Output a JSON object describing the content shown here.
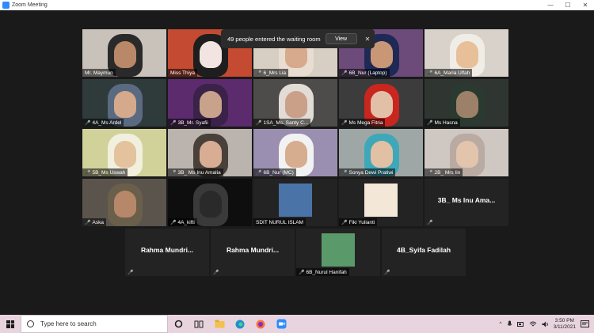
{
  "window": {
    "title": "Zoom Meeting",
    "minimize": "—",
    "maximize": "☐",
    "close": "✕"
  },
  "toast": {
    "message": "49 people entered the waiting room",
    "view_label": "View",
    "close_label": "✕"
  },
  "participants": [
    {
      "name": "Mr. Maymun",
      "muted": false,
      "type": "video",
      "bg": "#c9c2bb",
      "skin": "#b98868",
      "hair": "#2a2a2a"
    },
    {
      "name": "Miss Thiya",
      "muted": false,
      "type": "video",
      "speaking": true,
      "bg": "#c44a32",
      "skin": "#f2e4e0",
      "hair": "#1e1e1e"
    },
    {
      "name": "6_Mrs Lia",
      "muted": true,
      "type": "video",
      "bg": "#d7cfc4",
      "skin": "#d7a98d",
      "hair": "#e9ddd1"
    },
    {
      "name": "6B_Nur (Laptop)",
      "muted": true,
      "type": "video",
      "bg": "#6c4a7a",
      "skin": "#c99775",
      "hair": "#1e2a55"
    },
    {
      "name": "6A_Maria Ulfah",
      "muted": true,
      "type": "video",
      "bg": "#d8d2ca",
      "skin": "#e7c09a",
      "hair": "#f0ede6"
    },
    {
      "name": "4A_Ms Ardel",
      "muted": true,
      "type": "video",
      "bg": "#2f3a3a",
      "skin": "#d5a98b",
      "hair": "#5a6a80"
    },
    {
      "name": "3B_Mr. Syafii",
      "muted": true,
      "type": "video",
      "bg": "#5c2b6e",
      "skin": "#c9a28b",
      "hair": "#3b2248"
    },
    {
      "name": "1SA_Ms. Santy C...",
      "muted": true,
      "type": "video",
      "bg": "#4e4c4a",
      "skin": "#caa089",
      "hair": "#e2dcd6"
    },
    {
      "name": "Ms Mega Fitria",
      "muted": true,
      "type": "video",
      "bg": "#3c3c3c",
      "skin": "#e2c0a8",
      "hair": "#c8261e"
    },
    {
      "name": "Ms Hasna",
      "muted": true,
      "type": "video",
      "bg": "#2f3631",
      "skin": "#9d8068",
      "hair": "#2b3a30"
    },
    {
      "name": "5B_Ms Uswah",
      "muted": true,
      "type": "video",
      "bg": "#d1d29a",
      "skin": "#e4c29d",
      "hair": "#f1f0de"
    },
    {
      "name": "3B_ Ms Inu Amalia",
      "muted": true,
      "type": "video",
      "bg": "#bbb3ad",
      "skin": "#d9ad94",
      "hair": "#49403a"
    },
    {
      "name": "6B_Nur (MC)",
      "muted": true,
      "type": "video",
      "bg": "#9a8fb0",
      "skin": "#d6ad8e",
      "hair": "#f2f2f2"
    },
    {
      "name": "Sonya Dewi Pratiwi",
      "muted": true,
      "type": "video",
      "bg": "#9ea7a6",
      "skin": "#e2c0a3",
      "hair": "#3ea7b8"
    },
    {
      "name": "2B_ Mrs Iin",
      "muted": true,
      "type": "video",
      "bg": "#cfc7c1",
      "skin": "#e3c4ad",
      "hair": "#b9aaa2"
    },
    {
      "name": "Aska",
      "muted": true,
      "type": "video",
      "bg": "#5a544d",
      "skin": "#b7876a",
      "hair": "#6a5f4a"
    },
    {
      "name": "4A_kifti",
      "muted": true,
      "type": "video",
      "bg": "#0e0e0e",
      "skin": "#2a2a2a",
      "hair": "#3a3a3a"
    },
    {
      "name": "SDIT NURUL ISLAM",
      "muted": false,
      "type": "thumb",
      "bg": "#1f1f1f",
      "thumb": "#4a73a8"
    },
    {
      "name": "Fiki Yulianti",
      "muted": true,
      "type": "thumb",
      "bg": "#1f1f1f",
      "thumb": "#f3e7d8"
    },
    {
      "name": "3B_ Ms Inu Ama...",
      "muted": true,
      "type": "name"
    },
    {
      "name": "Rahma  Mundri...",
      "muted": true,
      "type": "name"
    },
    {
      "name": "Rahma  Mundri...",
      "muted": true,
      "type": "name"
    },
    {
      "name": "6B_Nurul Hanifah",
      "muted": true,
      "type": "thumb",
      "bg": "#1f1f1f",
      "thumb": "#5a9a6a"
    },
    {
      "name": "4B_Syifa Fadilah",
      "muted": true,
      "type": "name"
    }
  ],
  "taskbar": {
    "search_placeholder": "Type here to search",
    "time": "3:50 PM",
    "date": "3/11/2021",
    "accent": "#e8d4df"
  }
}
